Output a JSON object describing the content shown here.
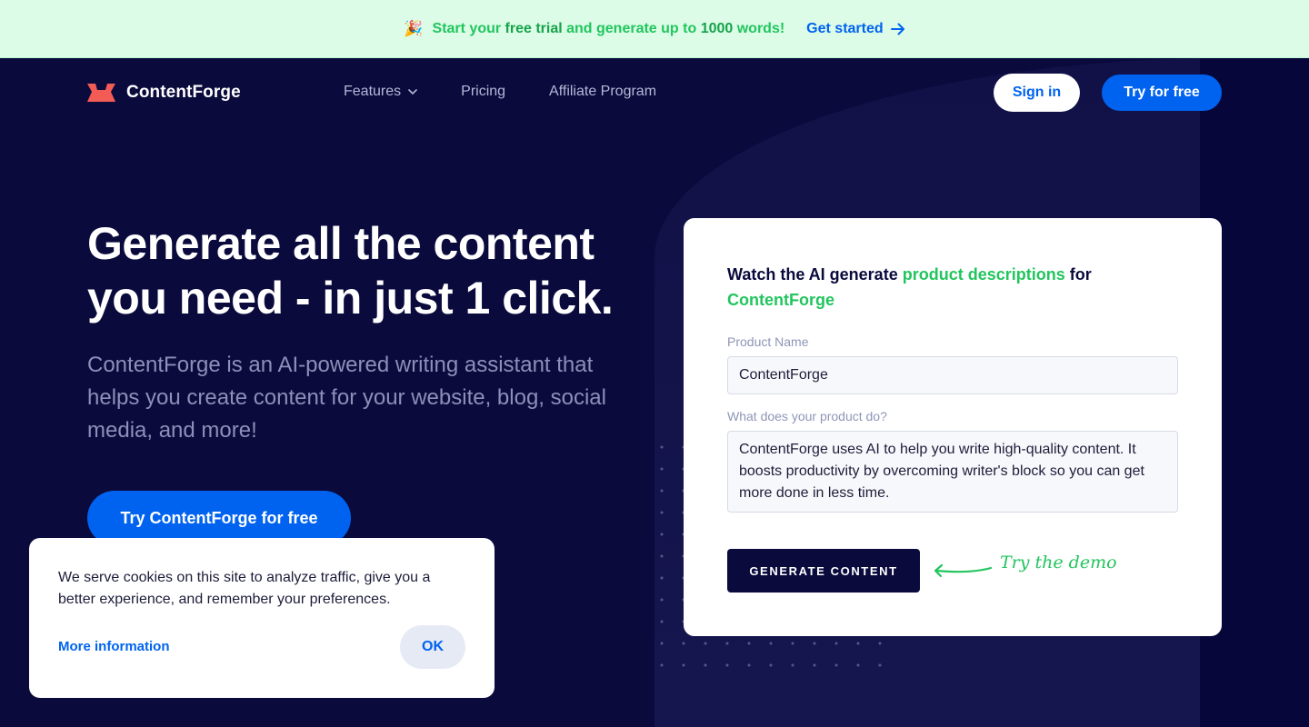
{
  "announcement": {
    "icon": "party-popper-icon",
    "prefix": "Start your ",
    "highlight1": "free trial",
    "middle": " and generate up to ",
    "highlight2": "1000",
    "suffix": " words!",
    "cta_label": "Get started",
    "cta_icon": "arrow-right-icon"
  },
  "nav": {
    "brand": "ContentForge",
    "links": [
      {
        "label": "Features",
        "has_dropdown": true
      },
      {
        "label": "Pricing"
      },
      {
        "label": "Affiliate Program"
      }
    ],
    "sign_in": "Sign in",
    "try_free": "Try for free"
  },
  "hero": {
    "title": "Generate all the content you need - in just 1 click.",
    "subtitle": "ContentForge is an AI-powered writing assistant that helps you create content for your website, blog, social media, and more!",
    "cta": "Try ContentForge for free"
  },
  "demo": {
    "title_prefix": "Watch the AI generate ",
    "title_highlight1": "product descriptions",
    "title_middle": " for ",
    "title_highlight2": "ContentForge",
    "product_name_label": "Product Name",
    "product_name_value": "ContentForge",
    "description_label": "What does your product do?",
    "description_value": "ContentForge uses AI to help you write high-quality content. It boosts productivity by overcoming writer's block so you can get more done in less time.",
    "generate_button": "GENERATE CONTENT",
    "hint": "Try the demo"
  },
  "cookie": {
    "text": "We serve cookies on this site to analyze traffic, give you a better experience, and remember your preferences.",
    "more_info": "More information",
    "ok": "OK"
  },
  "colors": {
    "background": "#0a0a3d",
    "brand_blue": "#0063f0",
    "accent_green": "#22c55e",
    "announcement_bg": "#dcfce7",
    "logo_red": "#f25c54"
  }
}
